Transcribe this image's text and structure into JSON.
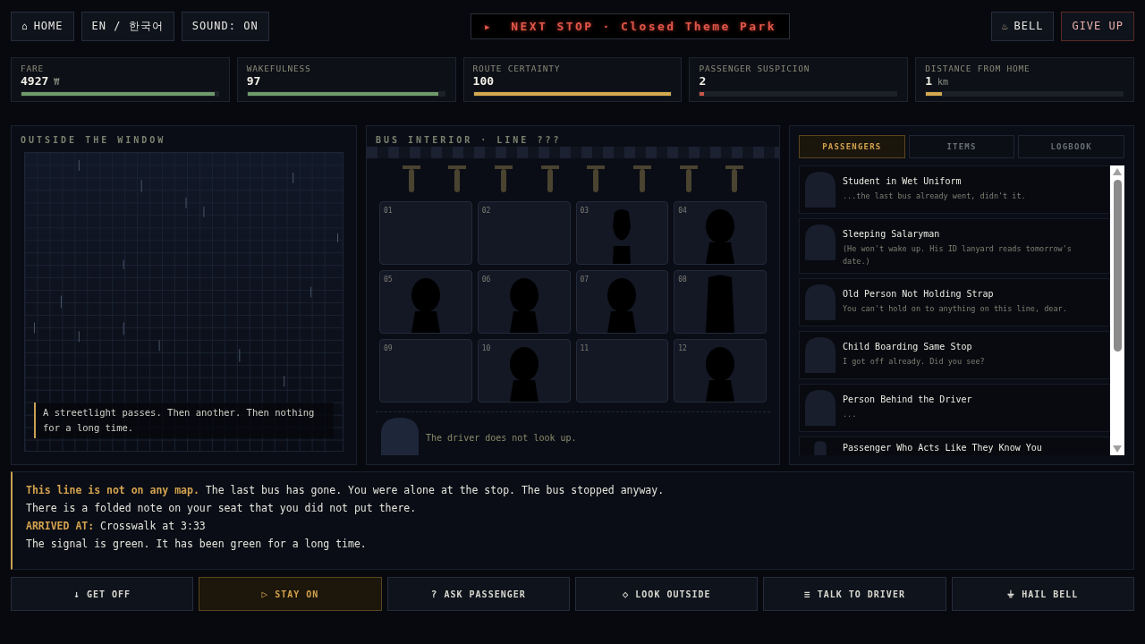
{
  "top_left": [
    {
      "icon": "⌂",
      "label": "HOME"
    },
    {
      "label": "EN / 한국어"
    },
    {
      "label": "SOUND: ON"
    }
  ],
  "next_stop": {
    "arrow": "▸",
    "text": "NEXT STOP · Closed Theme Park"
  },
  "top_right": [
    {
      "icon": "♨",
      "label": "BELL",
      "kind": "plain"
    },
    {
      "label": "GIVE UP",
      "kind": "danger"
    }
  ],
  "stats": [
    {
      "label": "FARE",
      "value": "4927",
      "unit": "₩",
      "level": 0.98,
      "color": "#6f9a6a"
    },
    {
      "label": "WAKEFULNESS",
      "value": "97",
      "level": 0.97,
      "color": "#6f9a6a"
    },
    {
      "label": "ROUTE CERTAINTY",
      "value": "100",
      "level": 1,
      "color": "#d4a94e"
    },
    {
      "label": "PASSENGER SUSPICION",
      "value": "2",
      "level": 0.02,
      "color": "#c8554a"
    },
    {
      "label": "DISTANCE FROM HOME",
      "value": "1",
      "unit": "km",
      "level": 0.08,
      "color": "#d4a94e"
    }
  ],
  "outside": {
    "title": "OUTSIDE THE WINDOW",
    "caption": "A streetlight passes. Then another. Then nothing for a long time."
  },
  "bus": {
    "title": "BUS INTERIOR · LINE ???",
    "seats": [
      {
        "number": "01",
        "kind": "empty"
      },
      {
        "number": "02",
        "kind": "empty"
      },
      {
        "number": "03",
        "kind": "slim"
      },
      {
        "number": "04",
        "kind": "round"
      },
      {
        "number": "05",
        "kind": "round"
      },
      {
        "number": "06",
        "kind": "round"
      },
      {
        "number": "07",
        "kind": "round"
      },
      {
        "number": "08",
        "kind": "tall"
      },
      {
        "number": "09",
        "kind": "empty"
      },
      {
        "number": "10",
        "kind": "round"
      },
      {
        "number": "11",
        "kind": "empty"
      },
      {
        "number": "12",
        "kind": "round"
      }
    ],
    "driver_text": "The driver does not look up."
  },
  "tabs": [
    {
      "label": "PASSENGERS",
      "selected": true
    },
    {
      "label": "ITEMS",
      "selected": false
    },
    {
      "label": "LOGBOOK",
      "selected": false
    }
  ],
  "passengers": [
    {
      "name": "Student in Wet Uniform",
      "line": "...the last bus already went, didn't it."
    },
    {
      "name": "Sleeping Salaryman",
      "line": "(He won't wake up. His ID lanyard reads tomorrow's date.)"
    },
    {
      "name": "Old Person Not Holding Strap",
      "line": "You can't hold on to anything on this line, dear."
    },
    {
      "name": "Child Boarding Same Stop",
      "line": "I got off already. Did you see?"
    },
    {
      "name": "Person Behind the Driver",
      "line": "..."
    },
    {
      "name": "Passenger Who Acts Like They Know You"
    }
  ],
  "log": [
    "**This line is not on any map.** The last bus has gone. You were alone at the stop. The bus stopped anyway.",
    "There is a folded note on your seat that you did not put there.",
    "**ARRIVED AT:** Crosswalk at 3:33",
    "The signal is green. It has been green for a long time."
  ],
  "actions": [
    {
      "icon": "↓",
      "label": "GET OFF",
      "selected": false
    },
    {
      "icon": "▷",
      "label": "STAY ON",
      "selected": true
    },
    {
      "icon": "?",
      "label": "ASK PASSENGER",
      "selected": false
    },
    {
      "icon": "◇",
      "label": "LOOK OUTSIDE",
      "selected": false
    },
    {
      "icon": "≡",
      "label": "TALK TO DRIVER",
      "selected": false
    },
    {
      "icon": "⏚",
      "label": "HAIL BELL",
      "selected": false
    }
  ]
}
